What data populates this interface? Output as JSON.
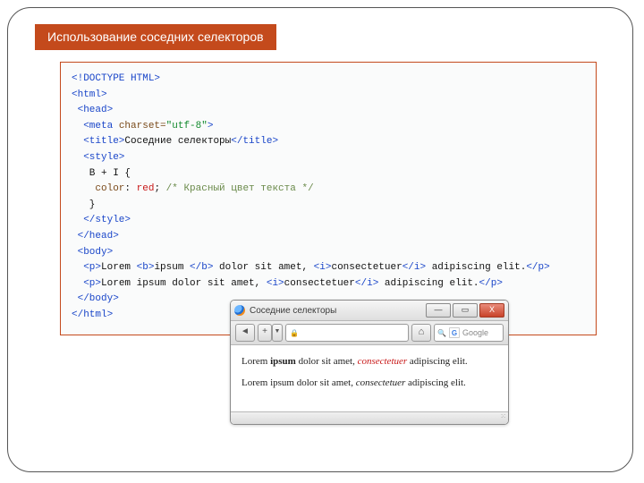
{
  "title": "Использование соседних селекторов",
  "code": {
    "doctype": "<!DOCTYPE HTML>",
    "html_open": "<html>",
    "head_open": "<head>",
    "meta_tag": "<meta",
    "meta_attr": " charset=",
    "meta_val": "\"utf-8\"",
    "meta_close": ">",
    "title_open": "<title>",
    "title_text": "Соседние селекторы",
    "title_close": "</title>",
    "style_open": "<style>",
    "rule_sel": "   B + I {",
    "rule_prop": "    color",
    "rule_colon": ": ",
    "rule_val": "red",
    "rule_semi": "; ",
    "rule_comment": "/* Красный цвет текста */",
    "rule_close": "   }",
    "style_close": "</style>",
    "head_close": "</head>",
    "body_open": "<body>",
    "p_open": "<p>",
    "l1_a": "Lorem ",
    "b_open": "<b>",
    "l1_b": "ipsum ",
    "b_close": "</b>",
    "l1_c": " dolor sit amet, ",
    "i_open": "<i>",
    "l1_d": "consectetuer",
    "i_close": "</i>",
    "l1_e": " adipiscing elit.",
    "p_close": "</p>",
    "l2_a": "Lorem ipsum dolor sit amet, ",
    "l2_b": "consectetuer",
    "l2_c": " adipiscing elit.",
    "body_close": "</body>",
    "html_close": "</html>"
  },
  "browser": {
    "tab_title": "Соседние селекторы",
    "win_min": "—",
    "win_max": "▭",
    "win_close": "X",
    "back": "◄",
    "plus": "+",
    "dd": "▼",
    "home": "⌂",
    "search_placeholder": "Google",
    "para1": {
      "a": "Lorem ",
      "b": "ipsum",
      "c": " dolor sit amet, ",
      "d": "consectetuer",
      "e": " adipiscing elit."
    },
    "para2": {
      "a": "Lorem ipsum dolor sit amet, ",
      "b": "consectetuer",
      "c": " adipiscing elit."
    }
  }
}
